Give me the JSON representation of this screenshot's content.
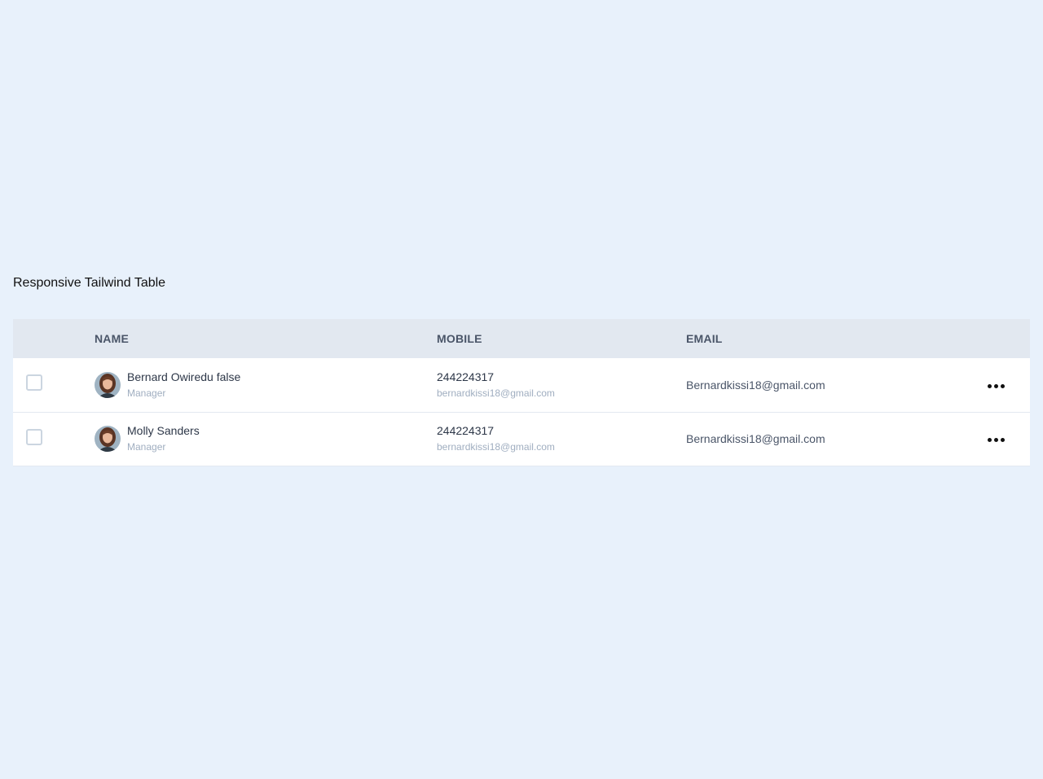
{
  "page": {
    "title": "Responsive Tailwind Table"
  },
  "table": {
    "columns": [
      "NAME",
      "MOBILE",
      "EMAIL"
    ],
    "rows": [
      {
        "name": "Bernard Owiredu false",
        "role": "Manager",
        "mobile": "244224317",
        "mobile_email": "bernardkissi18@gmail.com",
        "email": "Bernardkissi18@gmail.com"
      },
      {
        "name": "Molly Sanders",
        "role": "Manager",
        "mobile": "244224317",
        "mobile_email": "bernardkissi18@gmail.com",
        "email": "Bernardkissi18@gmail.com"
      }
    ]
  },
  "icons": {
    "row_actions": "more-horizontal-icon",
    "avatar": "user-avatar"
  },
  "colors": {
    "background": "#e8f1fb",
    "header_bg": "#e2e8f0",
    "header_text": "#4a5568",
    "muted_text": "#a0aec0"
  }
}
